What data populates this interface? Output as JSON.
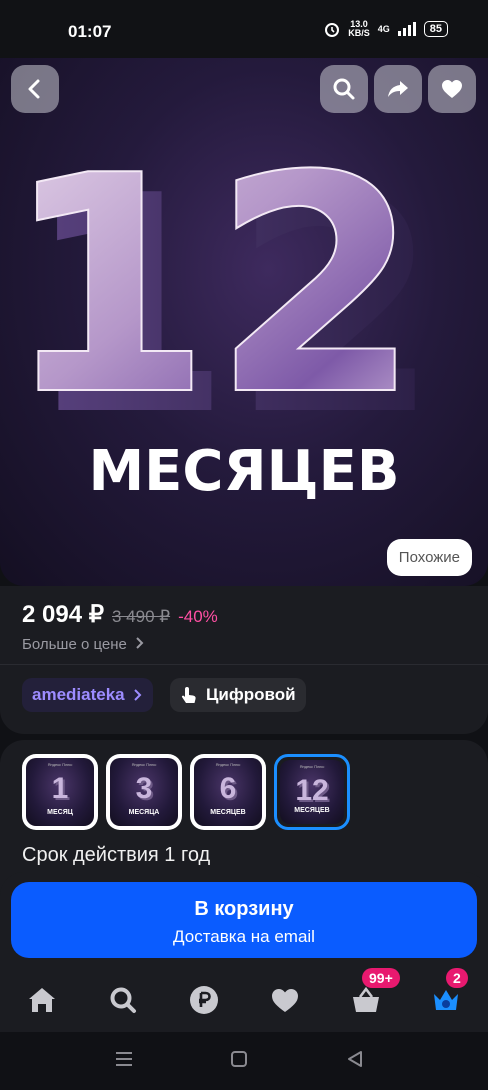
{
  "status": {
    "time": "01:07",
    "speed_value": "13.0",
    "speed_unit": "KB/S",
    "network": "4G",
    "battery": "85"
  },
  "hero": {
    "number": "12",
    "caption": "МЕСЯЦЕВ",
    "similar_label": "Похожие",
    "icons": {
      "back": "back-icon",
      "search": "search-icon",
      "share": "share-icon",
      "favorite": "heart-icon"
    }
  },
  "price": {
    "current": "2 094 ₽",
    "old": "3 490 ₽",
    "discount": "-40%",
    "more_label": "Больше о цене"
  },
  "chips": {
    "brand": "amediateka",
    "type": "Цифровой"
  },
  "variants": {
    "items": [
      {
        "number": "1",
        "word": "МЕСЯЦ",
        "top": "Яндекс Плюс"
      },
      {
        "number": "3",
        "word": "МЕСЯЦА",
        "top": "Яндекс Плюс"
      },
      {
        "number": "6",
        "word": "МЕСЯЦЕВ",
        "top": "Яндекс Плюс"
      },
      {
        "number": "12",
        "word": "МЕСЯЦЕВ",
        "top": "Яндекс Плюс"
      }
    ],
    "selected_index": 3,
    "validity": "Срок действия 1 год"
  },
  "cart": {
    "title": "В корзину",
    "subtitle": "Доставка на email"
  },
  "tabbar": {
    "items": [
      "home-icon",
      "search-icon",
      "ruble-icon",
      "heart-icon",
      "basket-icon",
      "profile-crown-icon"
    ],
    "basket_badge": "99+",
    "profile_badge": "2"
  },
  "colors": {
    "accent": "#0a5cff",
    "discount": "#ff4fa3",
    "badge": "#e8196f",
    "brand": "#9d8cff",
    "selected_border": "#1b8fff"
  }
}
